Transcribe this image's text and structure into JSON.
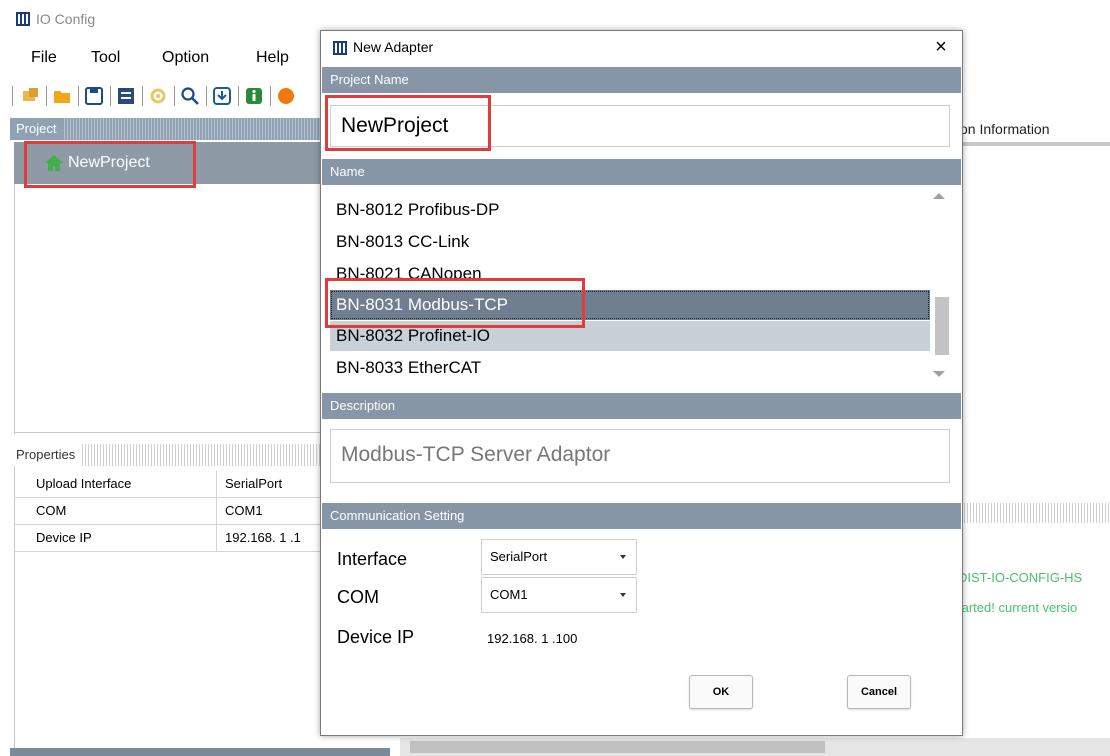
{
  "app": {
    "title": "IO Config"
  },
  "menu": [
    "File",
    "Tool",
    "Option",
    "Help"
  ],
  "toolbar": {
    "icons": [
      "add-device-icon",
      "open-folder-icon",
      "save-icon",
      "export-icon",
      "settings-icon",
      "search-icon",
      "download-icon",
      "info-icon",
      "status-icon"
    ]
  },
  "project_panel": {
    "header": "Project",
    "tree_root": "NewProject"
  },
  "properties_panel": {
    "header": "Properties",
    "rows": [
      {
        "key": "Upload Interface",
        "value": "SerialPort"
      },
      {
        "key": "COM",
        "value": "COM1"
      },
      {
        "key": "Device IP",
        "value": "192.168. 1 .1"
      }
    ]
  },
  "right_panel": {
    "header": "on Information",
    "log": [
      "DIST-IO-CONFIG-HS",
      "tarted! current versio"
    ]
  },
  "dialog": {
    "title": "New Adapter",
    "close": "×",
    "project_name_label": "Project Name",
    "project_name_value": "NewProject",
    "name_label": "Name",
    "adapters": [
      "BN-8012 Profibus-DP",
      "BN-8013 CC-Link",
      "BN-8021 CANopen",
      "BN-8031 Modbus-TCP",
      "BN-8032 Profinet-IO",
      "BN-8033 EtherCAT"
    ],
    "selected_adapter": "BN-8031 Modbus-TCP",
    "description_label": "Description",
    "description_value": "Modbus-TCP Server Adaptor",
    "comm_label": "Communication Setting",
    "interface_label": "Interface",
    "interface_value": "SerialPort",
    "com_label": "COM",
    "com_value": "COM1",
    "ip_label": "Device IP",
    "ip_value": "192.168. 1 .100",
    "ok": "OK",
    "cancel": "Cancel"
  },
  "colors": {
    "section": "#8696a6",
    "selected": "#6f7f8f",
    "highlight": "#e23b3b",
    "log": "#4ac26d"
  }
}
